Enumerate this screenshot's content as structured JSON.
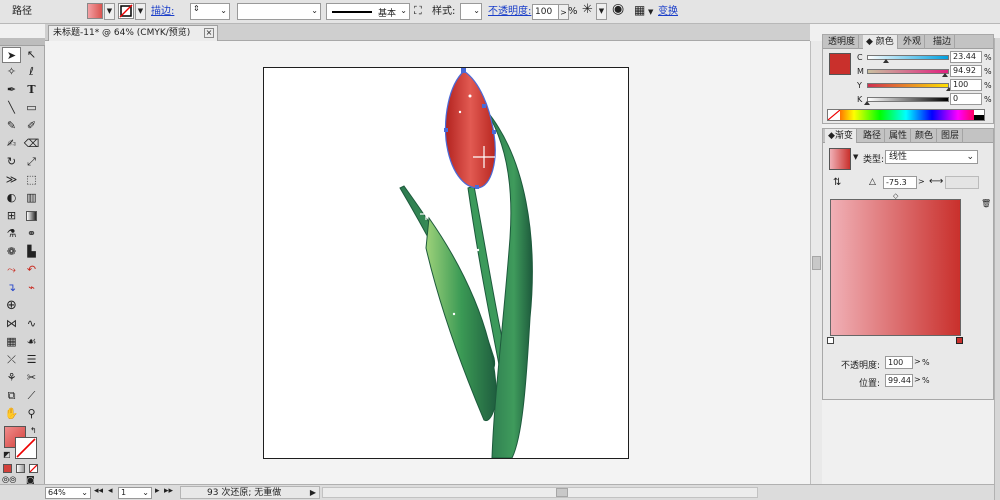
{
  "control": {
    "object_type": "路径",
    "stroke_label": "描边:",
    "stroke_profile": "基本",
    "style_label": "样式:",
    "opacity_label": "不透明度:",
    "opacity_value": "100",
    "opacity_unit": "%",
    "transform_label": "变换",
    "fill_color": "#d9534f"
  },
  "doc_tab": {
    "title": "未标题-11* @ 64% (CMYK/预览)",
    "close": "×"
  },
  "tools": {
    "icons": [
      "selection-tool",
      "direct-selection-tool",
      "magic-wand-tool",
      "lasso-tool",
      "pen-tool",
      "type-tool",
      "line-tool",
      "rectangle-tool",
      "paintbrush-tool",
      "pencil-tool",
      "blob-brush-tool",
      "eraser-tool",
      "rotate-tool",
      "scale-tool",
      "width-tool",
      "free-transform-tool",
      "shape-builder-tool",
      "perspective-grid-tool",
      "mesh-tool",
      "gradient-tool",
      "eyedropper-tool",
      "blend-tool",
      "symbol-sprayer-tool",
      "column-graph-tool",
      "artboard-tool",
      "slice-tool",
      "hand-tool",
      "zoom-tool"
    ]
  },
  "status": {
    "zoom": "64%",
    "page": "1",
    "undo_text": "93 次还原; 无重做"
  },
  "color_panel": {
    "tabs": [
      "透明度",
      "颜色",
      "外观",
      "描边"
    ],
    "active_tab": "颜色",
    "swatch": "#c9302c",
    "channels": [
      {
        "key": "C",
        "value": "23.44",
        "unit": "%",
        "fraction": 0.2344,
        "gradient": [
          "#ffffff",
          "#00a0e0"
        ]
      },
      {
        "key": "M",
        "value": "94.92",
        "unit": "%",
        "fraction": 0.9492,
        "gradient": [
          "#c9c0a0",
          "#e0207e"
        ]
      },
      {
        "key": "Y",
        "value": "100",
        "unit": "%",
        "fraction": 1.0,
        "gradient": [
          "#d03050",
          "#ffe000"
        ]
      },
      {
        "key": "K",
        "value": "0",
        "unit": "%",
        "fraction": 0.0,
        "gradient": [
          "#ffffff",
          "#000000"
        ]
      }
    ]
  },
  "gradient_panel": {
    "tabs": [
      "渐变",
      "路径",
      "属性",
      "颜色",
      "图层"
    ],
    "active_tab": "渐变",
    "type_label": "类型:",
    "type_value": "线性",
    "angle_value": "-75.3",
    "opacity_label": "不透明度:",
    "opacity_value": "100",
    "position_label": "位置:",
    "position_value": "99.44",
    "unit": "%",
    "start_color": "#f0b0b6",
    "end_color": "#c9302c"
  }
}
